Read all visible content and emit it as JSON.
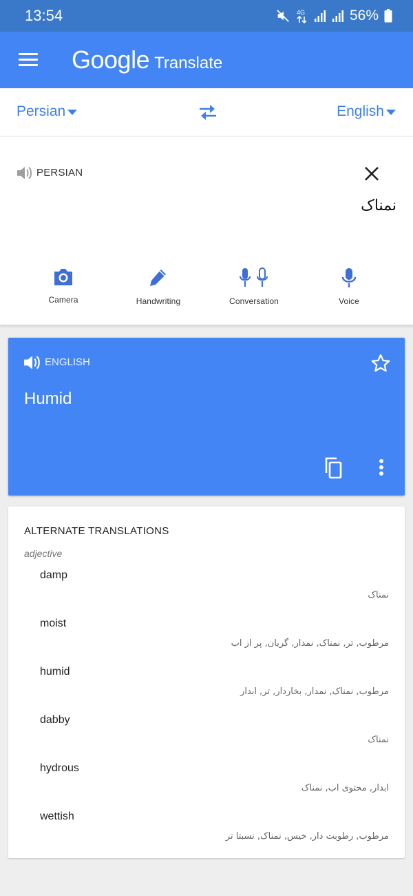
{
  "status_bar": {
    "time": "13:54",
    "network_label": "4G",
    "battery": "56%",
    "icons": [
      "mute-icon",
      "network-4g-icon",
      "signal-icon",
      "signal-icon",
      "battery-icon"
    ]
  },
  "app_bar": {
    "brand_google": "Google",
    "brand_translate": "Translate",
    "color": "#4385f4"
  },
  "languages": {
    "source": "Persian",
    "target": "English",
    "accent_color": "#3f80e8"
  },
  "input": {
    "language_label": "PERSIAN",
    "text": "نمناک",
    "tools": [
      {
        "label": "Camera",
        "icon": "camera-icon"
      },
      {
        "label": "Handwriting",
        "icon": "pen-icon"
      },
      {
        "label": "Conversation",
        "icon": "double-mic-icon"
      },
      {
        "label": "Voice",
        "icon": "mic-icon"
      }
    ]
  },
  "result": {
    "language_label": "ENGLISH",
    "text": "Humid",
    "icons": [
      "speaker-icon",
      "star-icon",
      "copy-icon",
      "more-vert-icon"
    ]
  },
  "alternates": {
    "title": "ALTERNATE TRANSLATIONS",
    "part_of_speech": "adjective",
    "items": [
      {
        "word": "damp",
        "back": "نمناک"
      },
      {
        "word": "moist",
        "back": "مرطوب, تر, نمناک, نمدار, گریان, پر از اب"
      },
      {
        "word": "humid",
        "back": "مرطوب, نمناک, نمدار, بخاردار, تر, ابدار"
      },
      {
        "word": "dabby",
        "back": "نمناک"
      },
      {
        "word": "hydrous",
        "back": "ابدار, محتوی اب, نمناک"
      },
      {
        "word": "wettish",
        "back": "مرطوب, رطوبت دار, خیس, نمناک, نسبتا تر"
      }
    ]
  }
}
